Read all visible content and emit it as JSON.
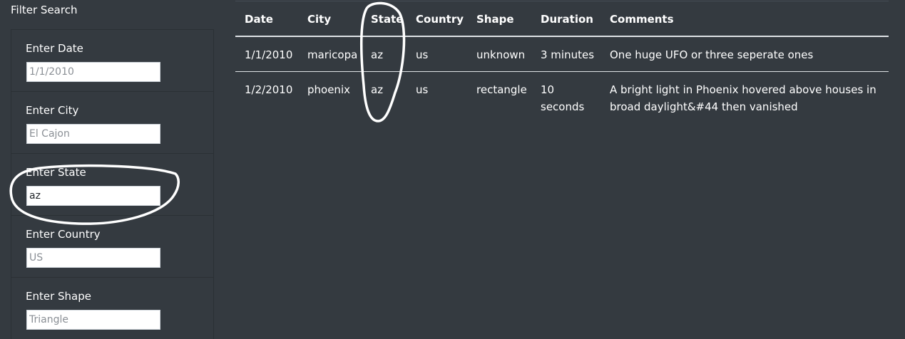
{
  "sidebar": {
    "title": "Filter Search",
    "filters": [
      {
        "label": "Enter Date",
        "value": "",
        "placeholder": "1/1/2010"
      },
      {
        "label": "Enter City",
        "value": "",
        "placeholder": "El Cajon"
      },
      {
        "label": "Enter State",
        "value": "az",
        "placeholder": ""
      },
      {
        "label": "Enter Country",
        "value": "",
        "placeholder": "US"
      },
      {
        "label": "Enter Shape",
        "value": "",
        "placeholder": "Triangle"
      }
    ]
  },
  "table": {
    "headers": [
      "Date",
      "City",
      "State",
      "Country",
      "Shape",
      "Duration",
      "Comments"
    ],
    "rows": [
      {
        "date": "1/1/2010",
        "city": "maricopa",
        "state": "az",
        "country": "us",
        "shape": "unknown",
        "duration": "3 minutes",
        "comments": "One huge UFO or three seperate ones"
      },
      {
        "date": "1/2/2010",
        "city": "phoenix",
        "state": "az",
        "country": "us",
        "shape": "rectangle",
        "duration": "10 seconds",
        "comments": "A bright light in Phoenix hovered above houses in broad daylight&#44 then vanished"
      }
    ]
  },
  "colors": {
    "background": "#343a40",
    "text": "#ffffff",
    "annotation": "#ffffff"
  }
}
